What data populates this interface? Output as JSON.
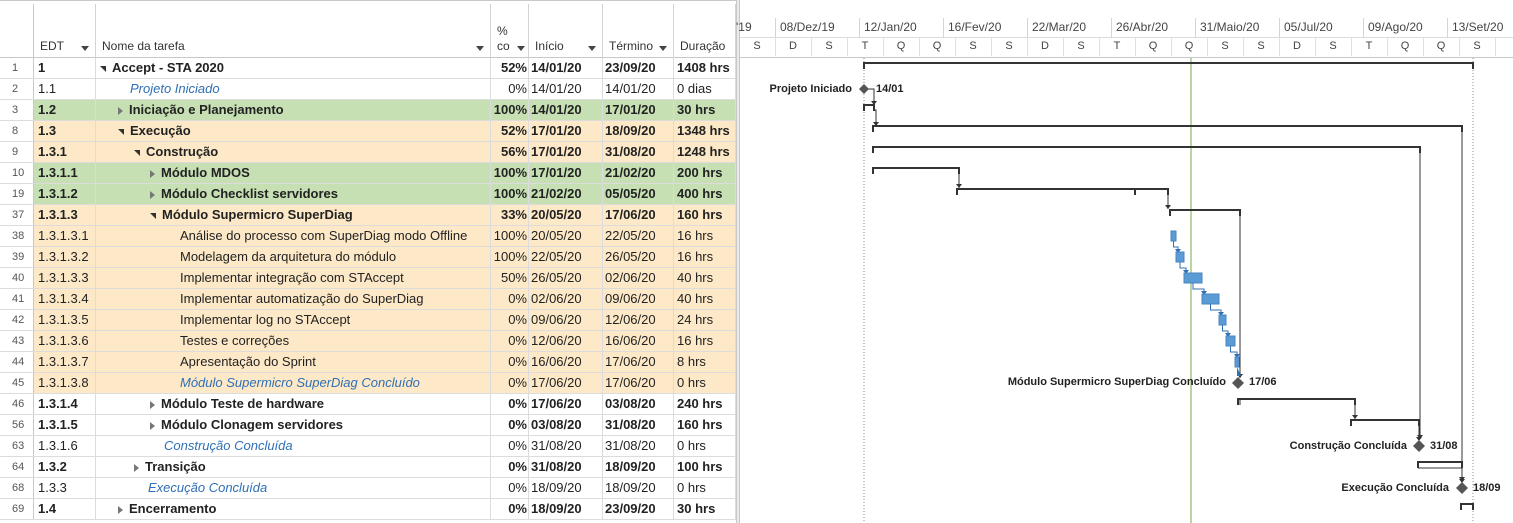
{
  "columns": {
    "edt": "EDT",
    "name": "Nome da tarefa",
    "pct_line1": "%",
    "pct_line2": "co",
    "inicio": "Início",
    "termino": "Término",
    "duracao": "Duração"
  },
  "rows": [
    {
      "n": "1",
      "edt": "1",
      "name": "Accept - STA 2020",
      "pct": "52%",
      "ini": "14/01/20",
      "ter": "23/09/20",
      "dur": "1408 hrs"
    },
    {
      "n": "2",
      "edt": "1.1",
      "name": "Projeto Iniciado",
      "pct": "0%",
      "ini": "14/01/20",
      "ter": "14/01/20",
      "dur": "0 dias"
    },
    {
      "n": "3",
      "edt": "1.2",
      "name": "Iniciação e Planejamento",
      "pct": "100%",
      "ini": "14/01/20",
      "ter": "17/01/20",
      "dur": "30 hrs"
    },
    {
      "n": "8",
      "edt": "1.3",
      "name": "Execução",
      "pct": "52%",
      "ini": "17/01/20",
      "ter": "18/09/20",
      "dur": "1348 hrs"
    },
    {
      "n": "9",
      "edt": "1.3.1",
      "name": "Construção",
      "pct": "56%",
      "ini": "17/01/20",
      "ter": "31/08/20",
      "dur": "1248 hrs"
    },
    {
      "n": "10",
      "edt": "1.3.1.1",
      "name": "Módulo MDOS",
      "pct": "100%",
      "ini": "17/01/20",
      "ter": "21/02/20",
      "dur": "200 hrs"
    },
    {
      "n": "19",
      "edt": "1.3.1.2",
      "name": "Módulo Checklist servidores",
      "pct": "100%",
      "ini": "21/02/20",
      "ter": "05/05/20",
      "dur": "400 hrs"
    },
    {
      "n": "37",
      "edt": "1.3.1.3",
      "name": "Módulo Supermicro SuperDiag",
      "pct": "33%",
      "ini": "20/05/20",
      "ter": "17/06/20",
      "dur": "160 hrs"
    },
    {
      "n": "38",
      "edt": "1.3.1.3.1",
      "name": "Análise do processo com SuperDiag modo Offline",
      "pct": "100%",
      "ini": "20/05/20",
      "ter": "22/05/20",
      "dur": "16 hrs"
    },
    {
      "n": "39",
      "edt": "1.3.1.3.2",
      "name": "Modelagem da arquitetura do módulo",
      "pct": "100%",
      "ini": "22/05/20",
      "ter": "26/05/20",
      "dur": "16 hrs"
    },
    {
      "n": "40",
      "edt": "1.3.1.3.3",
      "name": "Implementar integração com STAccept",
      "pct": "50%",
      "ini": "26/05/20",
      "ter": "02/06/20",
      "dur": "40 hrs"
    },
    {
      "n": "41",
      "edt": "1.3.1.3.4",
      "name": "Implementar automatização do SuperDiag",
      "pct": "0%",
      "ini": "02/06/20",
      "ter": "09/06/20",
      "dur": "40 hrs"
    },
    {
      "n": "42",
      "edt": "1.3.1.3.5",
      "name": "Implementar log no STAccept",
      "pct": "0%",
      "ini": "09/06/20",
      "ter": "12/06/20",
      "dur": "24 hrs"
    },
    {
      "n": "43",
      "edt": "1.3.1.3.6",
      "name": "Testes e correções",
      "pct": "0%",
      "ini": "12/06/20",
      "ter": "16/06/20",
      "dur": "16 hrs"
    },
    {
      "n": "44",
      "edt": "1.3.1.3.7",
      "name": "Apresentação do Sprint",
      "pct": "0%",
      "ini": "16/06/20",
      "ter": "17/06/20",
      "dur": "8 hrs"
    },
    {
      "n": "45",
      "edt": "1.3.1.3.8",
      "name": "Módulo Supermicro SuperDiag Concluído",
      "pct": "0%",
      "ini": "17/06/20",
      "ter": "17/06/20",
      "dur": "0 hrs"
    },
    {
      "n": "46",
      "edt": "1.3.1.4",
      "name": "Módulo Teste de hardware",
      "pct": "0%",
      "ini": "17/06/20",
      "ter": "03/08/20",
      "dur": "240 hrs"
    },
    {
      "n": "56",
      "edt": "1.3.1.5",
      "name": "Módulo Clonagem servidores",
      "pct": "0%",
      "ini": "03/08/20",
      "ter": "31/08/20",
      "dur": "160 hrs"
    },
    {
      "n": "63",
      "edt": "1.3.1.6",
      "name": "Construção Concluída",
      "pct": "0%",
      "ini": "31/08/20",
      "ter": "31/08/20",
      "dur": "0 hrs"
    },
    {
      "n": "64",
      "edt": "1.3.2",
      "name": "Transição",
      "pct": "0%",
      "ini": "31/08/20",
      "ter": "18/09/20",
      "dur": "100 hrs"
    },
    {
      "n": "68",
      "edt": "1.3.3",
      "name": "Execução Concluída",
      "pct": "0%",
      "ini": "18/09/20",
      "ter": "18/09/20",
      "dur": "0 hrs"
    },
    {
      "n": "69",
      "edt": "1.4",
      "name": "Encerramento",
      "pct": "0%",
      "ini": "18/09/20",
      "ter": "23/09/20",
      "dur": "30 hrs"
    }
  ],
  "timeline": {
    "top": [
      "'19",
      "08/Dez/19",
      "12/Jan/20",
      "16/Fev/20",
      "22/Mar/20",
      "26/Abr/20",
      "31/Maio/20",
      "05/Jul/20",
      "09/Ago/20",
      "13/Set/20"
    ],
    "days": [
      "S",
      "D",
      "S",
      "T",
      "Q",
      "Q",
      "S",
      "S",
      "D",
      "S",
      "T",
      "Q",
      "Q",
      "S",
      "S",
      "D",
      "S",
      "T",
      "Q",
      "Q",
      "S"
    ]
  },
  "gantt_labels": {
    "m1_name": "Projeto Iniciado",
    "m1_date": "14/01",
    "m2_name": "Módulo Supermicro SuperDiag Concluído",
    "m2_date": "17/06",
    "m3_name": "Construção Concluída",
    "m3_date": "31/08",
    "m4_name": "Execução Concluída",
    "m4_date": "18/09"
  },
  "colors": {
    "summary_green": "#c6e0b4",
    "summary_orange": "#fde9c7",
    "task_blue": "#5b9bd5",
    "milestone": "#555555",
    "milestone_text": "#2f6fb5",
    "status_line": "#70ad47"
  }
}
